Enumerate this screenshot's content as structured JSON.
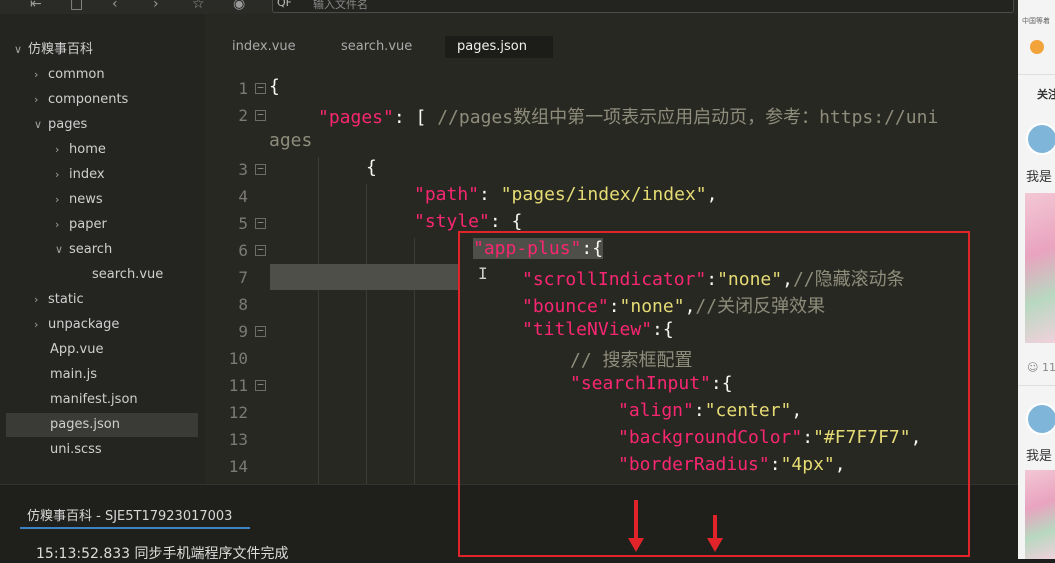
{
  "toolbar": {
    "search_prefix": "QF",
    "search_placeholder": "输入文件名",
    "icons": [
      "collapse-icon",
      "file-icon",
      "back-icon",
      "forward-icon",
      "star-icon",
      "run-icon"
    ]
  },
  "sidebar": {
    "items": [
      {
        "label": "仿糗事百科",
        "chev": "∨",
        "depth": 0
      },
      {
        "label": "common",
        "chev": "›",
        "depth": 1
      },
      {
        "label": "components",
        "chev": "›",
        "depth": 1
      },
      {
        "label": "pages",
        "chev": "∨",
        "depth": 1
      },
      {
        "label": "home",
        "chev": "›",
        "depth": 2
      },
      {
        "label": "index",
        "chev": "›",
        "depth": 2
      },
      {
        "label": "news",
        "chev": "›",
        "depth": 2
      },
      {
        "label": "paper",
        "chev": "›",
        "depth": 2
      },
      {
        "label": "search",
        "chev": "∨",
        "depth": 2
      },
      {
        "label": "search.vue",
        "chev": "",
        "depth": 3
      },
      {
        "label": "static",
        "chev": "›",
        "depth": 1
      },
      {
        "label": "unpackage",
        "chev": "›",
        "depth": 1
      },
      {
        "label": "App.vue",
        "chev": "",
        "depth": 1
      },
      {
        "label": "main.js",
        "chev": "",
        "depth": 1
      },
      {
        "label": "manifest.json",
        "chev": "",
        "depth": 1
      },
      {
        "label": "pages.json",
        "chev": "",
        "depth": 1,
        "selected": true
      },
      {
        "label": "uni.scss",
        "chev": "",
        "depth": 1
      }
    ]
  },
  "tabs": [
    {
      "label": "index.vue"
    },
    {
      "label": "search.vue"
    },
    {
      "label": "pages.json",
      "active": true
    }
  ],
  "editor": {
    "line_numbers": [
      "1",
      "2",
      "",
      "3",
      "4",
      "5",
      "6",
      "7",
      "8",
      "9",
      "10",
      "11",
      "12",
      "13",
      "14"
    ],
    "lines": {
      "l1": "{",
      "l2_key": "\"pages\"",
      "l2_rest": ": [ ",
      "l2_comment": "//pages数组中第一项表示应用启动页，参考：https://uni",
      "l2b": "ages",
      "l3": "{",
      "l4_key": "\"path\"",
      "l4_colon": ": ",
      "l4_val": "\"pages/index/index\"",
      "l4_end": ",",
      "l5_key": "\"style\"",
      "l5_rest": ": {",
      "l6_key": "\"app-plus\"",
      "l6_rest": ":{",
      "l7_key": "\"scrollIndicator\"",
      "l7_colon": ":",
      "l7_val": "\"none\"",
      "l7_end": ",",
      "l7_comment": "//隐藏滚动条",
      "l8_key": "\"bounce\"",
      "l8_colon": ":",
      "l8_val": "\"none\"",
      "l8_end": ",",
      "l8_comment": "//关闭反弹效果",
      "l9_key": "\"titleNView\"",
      "l9_rest": ":{",
      "l10_comment": "// 搜索框配置",
      "l11_key": "\"searchInput\"",
      "l11_rest": ":{",
      "l12_key": "\"align\"",
      "l12_colon": ":",
      "l12_val": "\"center\"",
      "l12_end": ",",
      "l13_key": "\"backgroundColor\"",
      "l13_colon": ":",
      "l13_val": "\"#F7F7F7\"",
      "l13_end": ",",
      "l14_key": "\"borderRadius\"",
      "l14_colon": ":",
      "l14_val": "\"4px\"",
      "l14_end": ","
    }
  },
  "console": {
    "tab_label": "仿糗事百科 - SJE5T17923017003",
    "log_line": "15:13:52.833 同步手机端程序文件完成"
  },
  "right_panel": {
    "top_text": "中国等着",
    "follow_text": "关注",
    "comment_1": "我是",
    "count": "11",
    "comment_2": "我是"
  },
  "colors": {
    "keyword": "#f92672",
    "string": "#e6db74",
    "comment": "#8e8c7a",
    "annotation": "#e0242a",
    "console_tab_underline": "#3b82c4"
  }
}
